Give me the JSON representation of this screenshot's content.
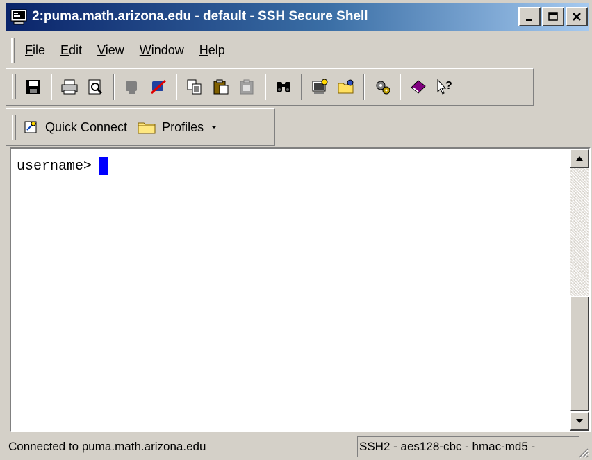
{
  "window": {
    "title": "2:puma.math.arizona.edu - default - SSH Secure Shell"
  },
  "menu": {
    "items": [
      {
        "label": "File",
        "accel": "F",
        "rest": "ile"
      },
      {
        "label": "Edit",
        "accel": "E",
        "rest": "dit"
      },
      {
        "label": "View",
        "accel": "V",
        "rest": "iew"
      },
      {
        "label": "Window",
        "accel": "W",
        "rest": "indow"
      },
      {
        "label": "Help",
        "accel": "H",
        "rest": "elp"
      }
    ]
  },
  "toolbar": {
    "icons": [
      "save-icon",
      "print-icon",
      "print-preview-icon",
      "connect-icon",
      "disconnect-icon",
      "copy-icon",
      "paste-icon",
      "paste-disabled-icon",
      "find-icon",
      "new-terminal-icon",
      "new-file-transfer-icon",
      "settings-icon",
      "help-topics-icon",
      "whats-this-icon"
    ]
  },
  "connectbar": {
    "quick_connect_label": "Quick Connect",
    "profiles_label": "Profiles"
  },
  "terminal": {
    "prompt": "username>"
  },
  "status": {
    "left": "Connected to puma.math.arizona.edu",
    "right": "SSH2 - aes128-cbc - hmac-md5 -"
  },
  "colors": {
    "titlebar_start": "#0a246a",
    "titlebar_end": "#a6caf0",
    "cursor": "#0000ff",
    "chrome": "#d4d0c8"
  }
}
